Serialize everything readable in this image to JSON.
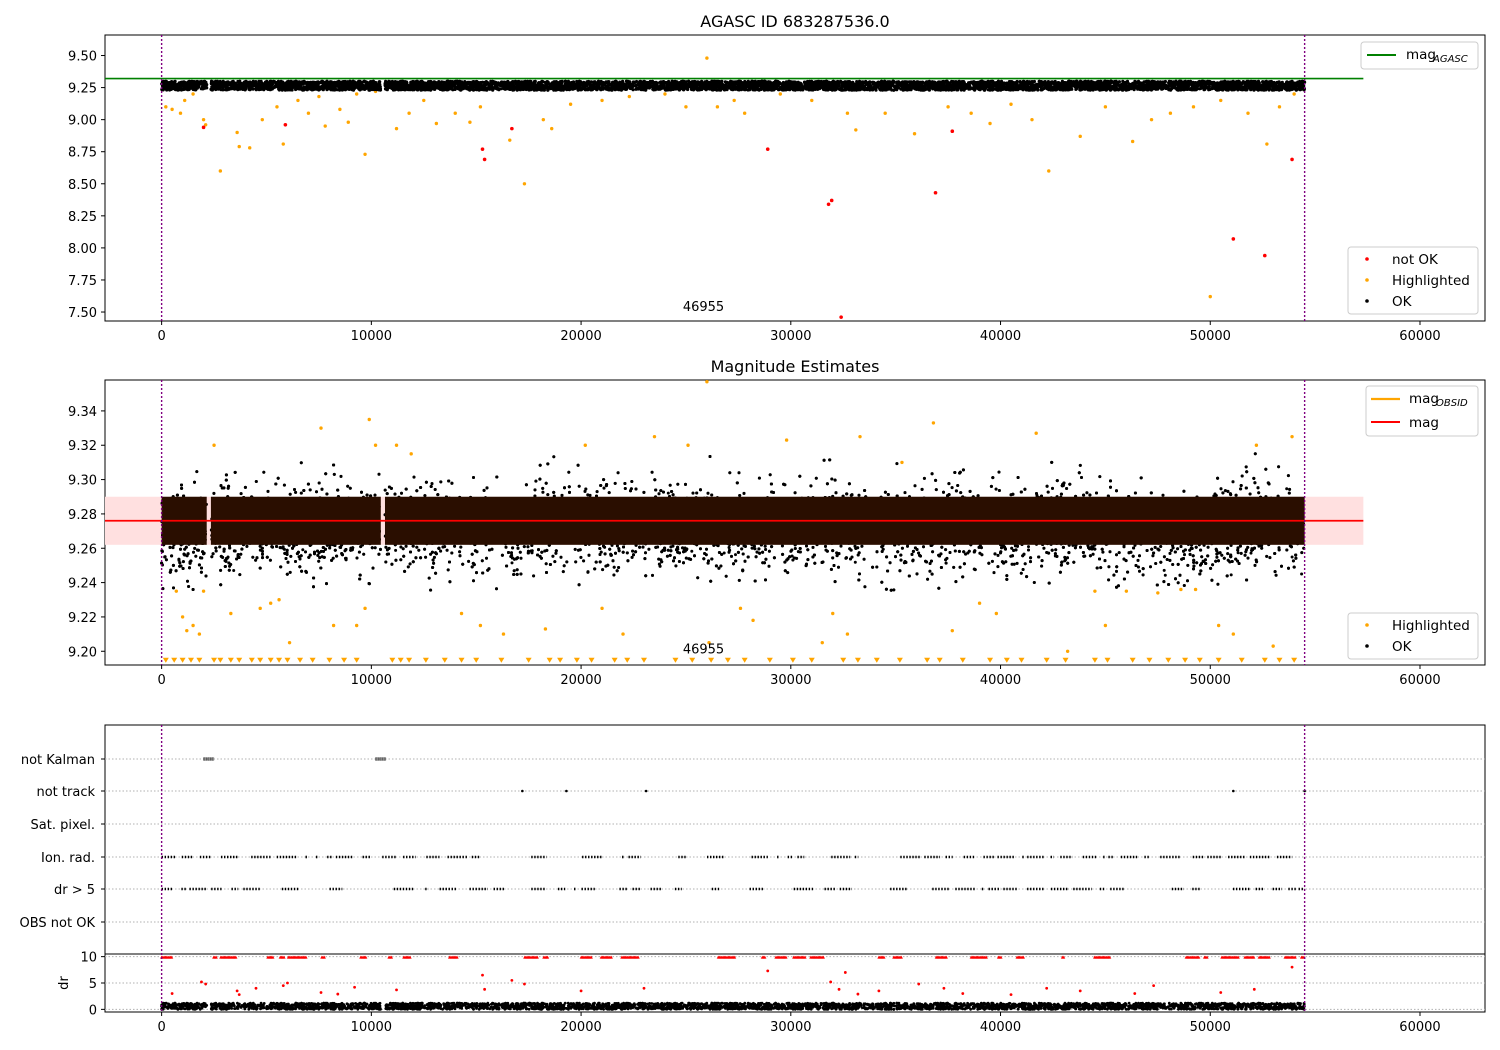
{
  "chart_data": [
    {
      "type": "scatter",
      "title": "AGASC ID 683287536.0",
      "xlim": [
        -2700,
        63100
      ],
      "ylim": [
        7.43,
        9.66
      ],
      "xticks": [
        0,
        10000,
        20000,
        30000,
        40000,
        50000,
        60000
      ],
      "yticks": [
        7.5,
        7.75,
        8.0,
        8.25,
        8.5,
        8.75,
        9.0,
        9.25,
        9.5
      ],
      "annotation": {
        "text": "46955",
        "x": 25900,
        "y": 7.5
      },
      "vlines": [
        0,
        54500
      ],
      "reference_line": {
        "label_main": "mag",
        "label_sub": "AGASC",
        "y": 9.32,
        "x_range": [
          -2700,
          57300
        ],
        "color": "#008000"
      },
      "band": {
        "center": 9.265,
        "spread": 0.035,
        "x_range": [
          0,
          54500
        ]
      },
      "gaps": [
        [
          2150,
          2350
        ],
        [
          10450,
          10650
        ]
      ],
      "legend_reference_placement": "top-right",
      "legend_points_placement": "bottom-right",
      "legend": [
        "not OK",
        "Highlighted",
        "OK"
      ],
      "colors": {
        "not_ok": "#ff0000",
        "highlighted": "#ffa500",
        "ok": "#000000"
      },
      "not_ok_points": [
        [
          2000,
          8.94
        ],
        [
          5900,
          8.96
        ],
        [
          15300,
          8.77
        ],
        [
          15400,
          8.69
        ],
        [
          16700,
          8.93
        ],
        [
          28900,
          8.77
        ],
        [
          31800,
          8.34
        ],
        [
          31950,
          8.37
        ],
        [
          32400,
          7.46
        ],
        [
          36900,
          8.43
        ],
        [
          37700,
          8.91
        ],
        [
          51100,
          8.07
        ],
        [
          52600,
          7.94
        ],
        [
          53900,
          8.69
        ]
      ],
      "highlighted_points": [
        [
          200,
          9.1
        ],
        [
          500,
          9.08
        ],
        [
          900,
          9.05
        ],
        [
          1100,
          9.15
        ],
        [
          1500,
          9.2
        ],
        [
          2000,
          9.0
        ],
        [
          2100,
          8.96
        ],
        [
          2800,
          8.6
        ],
        [
          3600,
          8.9
        ],
        [
          3700,
          8.79
        ],
        [
          4200,
          8.78
        ],
        [
          4800,
          9.0
        ],
        [
          5500,
          9.1
        ],
        [
          5800,
          8.81
        ],
        [
          6500,
          9.15
        ],
        [
          7000,
          9.05
        ],
        [
          7500,
          9.18
        ],
        [
          7800,
          8.95
        ],
        [
          8500,
          9.08
        ],
        [
          8900,
          8.98
        ],
        [
          9300,
          9.2
        ],
        [
          9700,
          8.73
        ],
        [
          10200,
          9.22
        ],
        [
          11200,
          8.93
        ],
        [
          11800,
          9.05
        ],
        [
          12500,
          9.15
        ],
        [
          13100,
          8.97
        ],
        [
          14000,
          9.05
        ],
        [
          14700,
          8.98
        ],
        [
          15200,
          9.1
        ],
        [
          16600,
          8.84
        ],
        [
          17300,
          8.5
        ],
        [
          18200,
          9.0
        ],
        [
          18600,
          8.93
        ],
        [
          19500,
          9.12
        ],
        [
          21000,
          9.15
        ],
        [
          22300,
          9.18
        ],
        [
          24000,
          9.2
        ],
        [
          25000,
          9.1
        ],
        [
          26000,
          9.48
        ],
        [
          26500,
          9.1
        ],
        [
          27300,
          9.15
        ],
        [
          27800,
          9.05
        ],
        [
          29500,
          9.2
        ],
        [
          31000,
          9.15
        ],
        [
          32700,
          9.05
        ],
        [
          33100,
          8.92
        ],
        [
          34500,
          9.05
        ],
        [
          35900,
          8.89
        ],
        [
          37500,
          9.1
        ],
        [
          38600,
          9.05
        ],
        [
          39500,
          8.97
        ],
        [
          40500,
          9.12
        ],
        [
          41500,
          9.0
        ],
        [
          42300,
          8.6
        ],
        [
          43800,
          8.87
        ],
        [
          45000,
          9.1
        ],
        [
          46300,
          8.83
        ],
        [
          47200,
          9.0
        ],
        [
          48100,
          9.05
        ],
        [
          49200,
          9.1
        ],
        [
          50000,
          7.62
        ],
        [
          50500,
          9.15
        ],
        [
          51800,
          9.05
        ],
        [
          52700,
          8.81
        ],
        [
          53300,
          9.1
        ],
        [
          54000,
          9.2
        ]
      ],
      "ok_band": true
    },
    {
      "type": "scatter",
      "title": "Magnitude Estimates",
      "xlim": [
        -2700,
        63100
      ],
      "ylim": [
        9.192,
        9.358
      ],
      "xticks": [
        0,
        10000,
        20000,
        30000,
        40000,
        50000,
        60000
      ],
      "yticks": [
        9.2,
        9.22,
        9.24,
        9.26,
        9.28,
        9.3,
        9.32,
        9.34
      ],
      "annotation": {
        "text": "46955",
        "x": 25900,
        "y": 9.198
      },
      "vlines": [
        0,
        54500
      ],
      "mean_line": {
        "y": 9.276,
        "x_range": [
          -2700,
          57300
        ],
        "color": "#ff0000"
      },
      "shade": {
        "y_range": [
          9.262,
          9.29
        ],
        "x_range": [
          -2700,
          57300
        ],
        "color": "#ffe0e0"
      },
      "core_band": {
        "y_range": [
          9.262,
          9.29
        ],
        "color": "#2a0e00"
      },
      "spread_band": {
        "center": 9.272,
        "spread": 0.04
      },
      "gaps": [
        [
          2150,
          2350
        ],
        [
          10450,
          10650
        ]
      ],
      "legend_lines_placement": "top-right",
      "legend_points_placement": "bottom-right",
      "legend_lines": [
        {
          "label_main": "mag",
          "label_sub": "OBSID",
          "color": "#ffa500"
        },
        {
          "label_main": "mag",
          "label_sub": "",
          "color": "#ff0000"
        }
      ],
      "legend": [
        "Highlighted",
        "OK"
      ],
      "colors": {
        "highlighted": "#ffa500",
        "ok": "#000000"
      },
      "lower_limit_y": 9.1945,
      "lower_limit_x": [
        200,
        600,
        1000,
        1400,
        1800,
        2500,
        2800,
        3300,
        3700,
        4300,
        4700,
        5200,
        5600,
        6000,
        6600,
        7200,
        8000,
        8700,
        9300,
        11000,
        11400,
        11800,
        12600,
        13500,
        14300,
        15000,
        16200,
        17500,
        18500,
        19000,
        19800,
        20500,
        21600,
        22200,
        23000,
        24500,
        25300,
        26200,
        27000,
        27800,
        29000,
        30100,
        31000,
        32500,
        33200,
        34100,
        35200,
        36500,
        37100,
        38200,
        39500,
        40300,
        41000,
        42200,
        43100,
        44500,
        45100,
        46300,
        47100,
        48000,
        48800,
        49500,
        50400,
        51500,
        52600,
        53300,
        54000
      ],
      "highlighted_points": [
        [
          700,
          9.235
        ],
        [
          1000,
          9.22
        ],
        [
          1200,
          9.212
        ],
        [
          1500,
          9.215
        ],
        [
          1800,
          9.21
        ],
        [
          2000,
          9.235
        ],
        [
          2500,
          9.32
        ],
        [
          3300,
          9.222
        ],
        [
          4700,
          9.225
        ],
        [
          5200,
          9.228
        ],
        [
          5600,
          9.23
        ],
        [
          6100,
          9.205
        ],
        [
          7600,
          9.33
        ],
        [
          8200,
          9.215
        ],
        [
          9300,
          9.215
        ],
        [
          9700,
          9.225
        ],
        [
          9900,
          9.335
        ],
        [
          10200,
          9.32
        ],
        [
          11200,
          9.32
        ],
        [
          11900,
          9.315
        ],
        [
          14300,
          9.222
        ],
        [
          15200,
          9.215
        ],
        [
          16300,
          9.21
        ],
        [
          18300,
          9.213
        ],
        [
          20200,
          9.32
        ],
        [
          21000,
          9.225
        ],
        [
          22000,
          9.21
        ],
        [
          23500,
          9.325
        ],
        [
          25100,
          9.32
        ],
        [
          26000,
          9.357
        ],
        [
          26100,
          9.205
        ],
        [
          27600,
          9.225
        ],
        [
          28200,
          9.218
        ],
        [
          29800,
          9.323
        ],
        [
          31500,
          9.205
        ],
        [
          32000,
          9.222
        ],
        [
          32700,
          9.21
        ],
        [
          33300,
          9.325
        ],
        [
          35300,
          9.31
        ],
        [
          36800,
          9.333
        ],
        [
          37700,
          9.212
        ],
        [
          39000,
          9.228
        ],
        [
          39800,
          9.222
        ],
        [
          41700,
          9.327
        ],
        [
          43200,
          9.2
        ],
        [
          44500,
          9.235
        ],
        [
          45000,
          9.215
        ],
        [
          46000,
          9.235
        ],
        [
          47500,
          9.234
        ],
        [
          48600,
          9.236
        ],
        [
          49300,
          9.236
        ],
        [
          50400,
          9.215
        ],
        [
          51100,
          9.21
        ],
        [
          52200,
          9.32
        ],
        [
          53000,
          9.203
        ],
        [
          53900,
          9.325
        ]
      ],
      "ok_band": true
    },
    {
      "type": "scatter",
      "title": "",
      "xlim": [
        -2700,
        63100
      ],
      "xticks": [
        0,
        10000,
        20000,
        30000,
        40000,
        50000,
        60000
      ],
      "vlines": [
        0,
        54500
      ],
      "flag_rows": [
        "not Kalman",
        "not track",
        "Sat. pixel.",
        "Ion. rad.",
        "dr > 5",
        "OBS not OK"
      ],
      "flag_marks": {
        "not Kalman": [
          [
            2000,
            2500
          ],
          [
            10200,
            10700
          ]
        ],
        "not track": [
          17200,
          19300,
          23100,
          51100,
          54500
        ],
        "Sat. pixel.": [],
        "Ion. rad.": "frequent",
        "dr > 5": "frequent",
        "OBS not OK": []
      },
      "ylabel_dr": "dr",
      "dr_ylim": [
        -0.5,
        10.5
      ],
      "dr_yticks": [
        0,
        5,
        10
      ],
      "dr_high_points": [
        [
          500,
          3.0
        ],
        [
          1900,
          5.2
        ],
        [
          2100,
          4.8
        ],
        [
          3600,
          3.5
        ],
        [
          3700,
          2.8
        ],
        [
          4500,
          4.0
        ],
        [
          5800,
          4.5
        ],
        [
          6000,
          5.0
        ],
        [
          7600,
          3.2
        ],
        [
          8400,
          2.9
        ],
        [
          9200,
          4.2
        ],
        [
          11200,
          3.7
        ],
        [
          15300,
          6.5
        ],
        [
          15400,
          3.8
        ],
        [
          16700,
          5.5
        ],
        [
          17300,
          4.8
        ],
        [
          20000,
          3.5
        ],
        [
          23000,
          4.0
        ],
        [
          28900,
          7.3
        ],
        [
          31900,
          5.2
        ],
        [
          32300,
          3.8
        ],
        [
          32600,
          7.0
        ],
        [
          33200,
          2.9
        ],
        [
          34200,
          3.5
        ],
        [
          36100,
          4.8
        ],
        [
          37300,
          4.0
        ],
        [
          38200,
          3.0
        ],
        [
          40500,
          2.8
        ],
        [
          42200,
          4.0
        ],
        [
          43800,
          3.5
        ],
        [
          46400,
          3.0
        ],
        [
          47300,
          4.5
        ],
        [
          50500,
          3.2
        ],
        [
          52100,
          3.8
        ],
        [
          53900,
          8.0
        ]
      ],
      "colors": {
        "dr_high": "#ff0000",
        "dr_ok": "#000000",
        "dr_cap": "#ff0000"
      }
    }
  ]
}
